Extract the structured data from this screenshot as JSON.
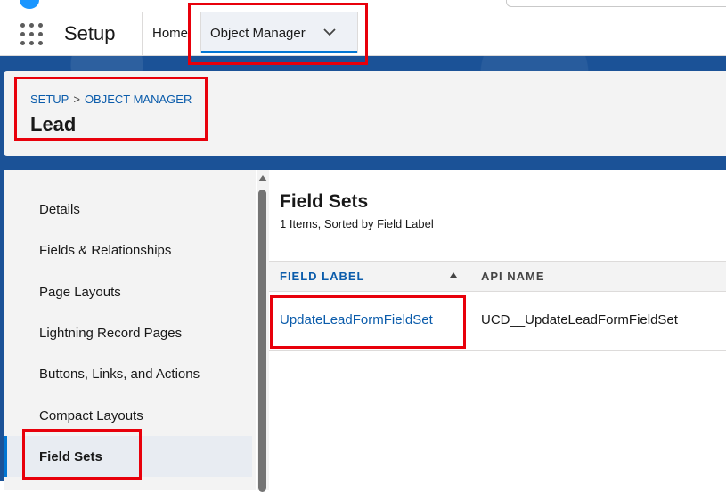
{
  "nav": {
    "app_name": "Setup",
    "tabs": [
      {
        "label": "Home"
      },
      {
        "label": "Object Manager"
      }
    ]
  },
  "header": {
    "breadcrumb": [
      "SETUP",
      "OBJECT MANAGER"
    ],
    "breadcrumb_separator": ">",
    "title": "Lead"
  },
  "sidebar": {
    "items": [
      {
        "label": "Details"
      },
      {
        "label": "Fields & Relationships"
      },
      {
        "label": "Page Layouts"
      },
      {
        "label": "Lightning Record Pages"
      },
      {
        "label": "Buttons, Links, and Actions"
      },
      {
        "label": "Compact Layouts"
      },
      {
        "label": "Field Sets",
        "active": true
      }
    ]
  },
  "main": {
    "title": "Field Sets",
    "subtitle": "1 Items, Sorted by Field Label",
    "columns": [
      "FIELD LABEL",
      "API NAME"
    ],
    "rows": [
      {
        "field_label": "UpdateLeadFormFieldSet",
        "api_name": "UCD__UpdateLeadFormFieldSet"
      }
    ]
  },
  "colors": {
    "accent": "#0176d3",
    "link": "#0b5cab",
    "band": "#1b5297",
    "highlight": "#e8000b"
  }
}
